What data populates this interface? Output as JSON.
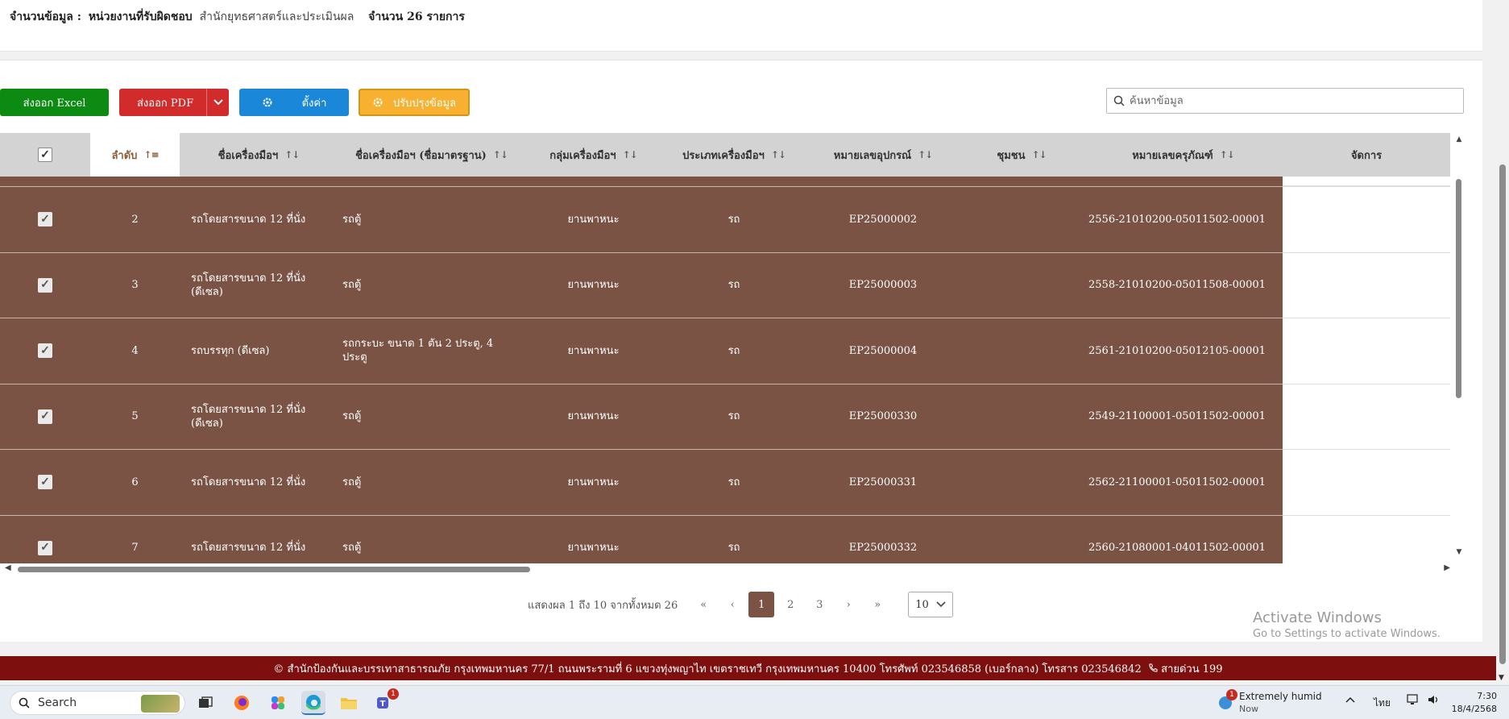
{
  "summary": {
    "label": "จำนวนข้อมูล :",
    "unit_label": "หน่วยงานที่รับผิดชอบ",
    "unit_value": "สำนักยุทธศาสตร์และประเมินผล",
    "count": "จำนวน 26 รายการ"
  },
  "toolbar": {
    "excel": "ส่งออก Excel",
    "pdf": "ส่งออก PDF",
    "settings": "ตั้งค่า",
    "update": "ปรับปรุงข้อมูล"
  },
  "search": {
    "placeholder": "ค้นหาข้อมูล"
  },
  "table": {
    "headers": {
      "order": "ลำดับ",
      "name": "ชื่อเครื่องมือฯ",
      "std_name": "ชื่อเครื่องมือฯ (ชื่อมาตรฐาน)",
      "group": "กลุ่มเครื่องมือฯ",
      "type": "ประเภทเครื่องมือฯ",
      "equip_no": "หมายเลขอุปกรณ์",
      "community": "ชุมชน",
      "asset_no": "หมายเลขครุภัณฑ์",
      "manage": "จัดการ"
    },
    "rows": [
      {
        "order": "2",
        "name": "รถโดยสารขนาด 12 ที่นั่ง",
        "std_name": "รถตู้",
        "group": "ยานพาหนะ",
        "type": "รถ",
        "equip_no": "EP25000002",
        "community": "",
        "asset_no": "2556-21010200-05011502-00001"
      },
      {
        "order": "3",
        "name": "รถโดยสารขนาด 12 ที่นั่ง (ดีเซล)",
        "std_name": "รถตู้",
        "group": "ยานพาหนะ",
        "type": "รถ",
        "equip_no": "EP25000003",
        "community": "",
        "asset_no": "2558-21010200-05011508-00001"
      },
      {
        "order": "4",
        "name": "รถบรรทุก (ดีเซล)",
        "std_name": "รถกระบะ ขนาด 1 ตัน 2 ประตู, 4 ประตู",
        "group": "ยานพาหนะ",
        "type": "รถ",
        "equip_no": "EP25000004",
        "community": "",
        "asset_no": "2561-21010200-05012105-00001"
      },
      {
        "order": "5",
        "name": "รถโดยสารขนาด 12 ที่นั่ง (ดีเซล)",
        "std_name": "รถตู้",
        "group": "ยานพาหนะ",
        "type": "รถ",
        "equip_no": "EP25000330",
        "community": "",
        "asset_no": "2549-21100001-05011502-00001"
      },
      {
        "order": "6",
        "name": "รถโดยสารขนาด 12 ที่นั่ง",
        "std_name": "รถตู้",
        "group": "ยานพาหนะ",
        "type": "รถ",
        "equip_no": "EP25000331",
        "community": "",
        "asset_no": "2562-21100001-05011502-00001"
      },
      {
        "order": "7",
        "name": "รถโดยสารขนาด 12 ที่นั่ง",
        "std_name": "รถตู้",
        "group": "ยานพาหนะ",
        "type": "รถ",
        "equip_no": "EP25000332",
        "community": "",
        "asset_no": "2560-21080001-04011502-00001"
      }
    ]
  },
  "pagination": {
    "info": "แสดงผล 1 ถึง 10 จากทั้งหมด 26",
    "first": "«",
    "prev": "‹",
    "pages": [
      "1",
      "2",
      "3"
    ],
    "current": "1",
    "next": "›",
    "last": "»",
    "per_page": "10"
  },
  "watermark": {
    "title": "Activate Windows",
    "subtitle": "Go to Settings to activate Windows."
  },
  "footer": {
    "text": "© สำนักป้องกันและบรรเทาสาธารณภัย กรุงเทพมหานคร 77/1 ถนนพระรามที่ 6 แขวงทุ่งพญาไท เขตราชเทวี กรุงเทพมหานคร 10400 โทรศัพท์ 023546858 (เบอร์กลาง) โทรสาร 023546842",
    "hotline": "สายด่วน 199"
  },
  "taskbar": {
    "search": "Search",
    "weather_text": "Extremely humid",
    "weather_sub": "Now",
    "weather_badge": "1",
    "teams_badge": "1",
    "lang": "ไทย",
    "time": "7:30",
    "date": "18/4/2568"
  },
  "colors": {
    "row_bg": "#7a5344",
    "excel": "#0c8a12",
    "pdf": "#d22b2b",
    "settings": "#1a87d9",
    "update": "#f7b02f",
    "footer": "#7e0f0f"
  }
}
